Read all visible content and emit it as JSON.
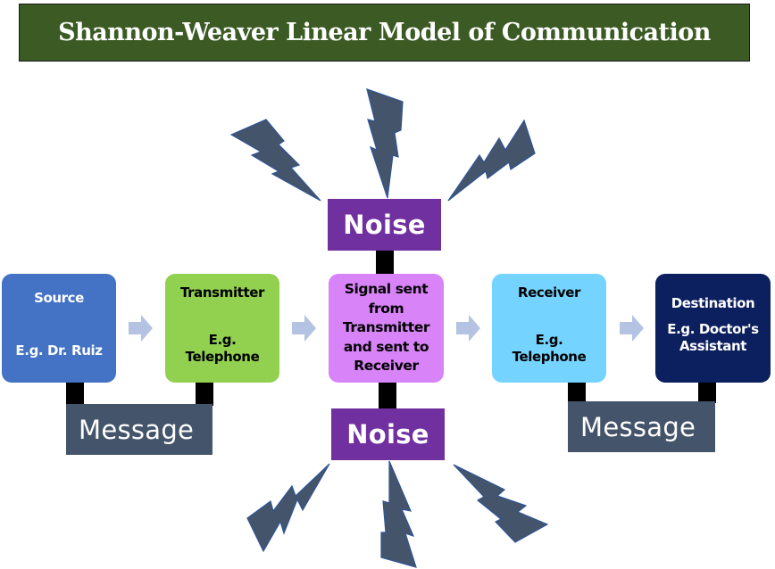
{
  "title": "Shannon-Weaver Linear Model of Communication",
  "colors": {
    "title_bg": "#3b5a24",
    "source": "#4472c4",
    "transmitter": "#92d050",
    "signal": "#d883f7",
    "receiver": "#75d4ff",
    "destination": "#0c1f5e",
    "noise": "#7030a0",
    "message": "#44546a",
    "arrow": "#b4c3e2",
    "lightning": "#44546a",
    "lightning_outline": "#2f5597"
  },
  "nodes": {
    "source": {
      "label": "Source",
      "example": "E.g. Dr. Ruiz"
    },
    "transmitter": {
      "label": "Transmitter",
      "example_line1": "E.g.",
      "example_line2": "Telephone"
    },
    "signal": {
      "line1": "Signal sent",
      "line2": "from",
      "line3": "Transmitter",
      "line4": "and sent to",
      "line5": "Receiver"
    },
    "receiver": {
      "label": "Receiver",
      "example_line1": "E.g.",
      "example_line2": "Telephone"
    },
    "destination": {
      "label": "Destination",
      "example_line1": "E.g. Doctor's",
      "example_line2": "Assistant"
    }
  },
  "noise": {
    "top_label": "Noise",
    "bottom_label": "Noise"
  },
  "message": {
    "left_label": "Message",
    "right_label": "Message"
  },
  "icons": {
    "arrow": "right-arrow-icon",
    "noise": "lightning-bolt-icon"
  }
}
